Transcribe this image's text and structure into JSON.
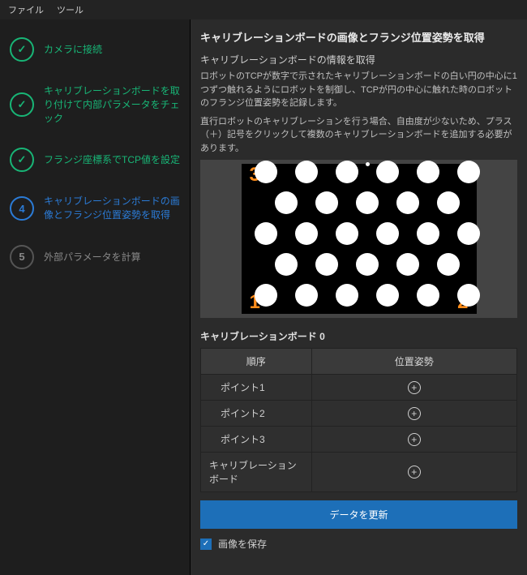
{
  "menu": {
    "file": "ファイル",
    "tool": "ツール"
  },
  "steps": [
    {
      "num": "✓",
      "label": "カメラに接続",
      "state": "done"
    },
    {
      "num": "✓",
      "label": "キャリブレーションボードを取り付けて内部パラメータをチェック",
      "state": "done"
    },
    {
      "num": "✓",
      "label": "フランジ座標系でTCP値を設定",
      "state": "done"
    },
    {
      "num": "4",
      "label": "キャリブレーションボードの画像とフランジ位置姿勢を取得",
      "state": "active"
    },
    {
      "num": "5",
      "label": "外部パラメータを計算",
      "state": "pending"
    }
  ],
  "main": {
    "title": "キャリブレーションボードの画像とフランジ位置姿勢を取得",
    "subtitle": "キャリブレーションボードの情報を取得",
    "desc1": "ロボットのTCPが数字で示されたキャリブレーションボードの白い円の中心に1つずつ触れるようにロボットを制御し、TCPが円の中心に触れた時のロボットのフランジ位置姿勢を記録します。",
    "desc2": "直行ロボットのキャリブレーションを行う場合、自由度が少ないため、プラス（＋）記号をクリックして複数のキャリブレーションボードを追加する必要があります。",
    "board_title": "キャリブレーションボード 0",
    "table": {
      "col_order": "順序",
      "col_pose": "位置姿勢",
      "rows": [
        {
          "label": "ポイント1"
        },
        {
          "label": "ポイント2"
        },
        {
          "label": "ポイント3"
        },
        {
          "label": "キャリブレーションボード"
        }
      ]
    },
    "update_btn": "データを更新",
    "save_image_label": "画像を保存",
    "save_image_checked": true,
    "marker_labels": {
      "topLeft": "3",
      "bottomLeft": "1",
      "bottomRight": "2"
    }
  }
}
